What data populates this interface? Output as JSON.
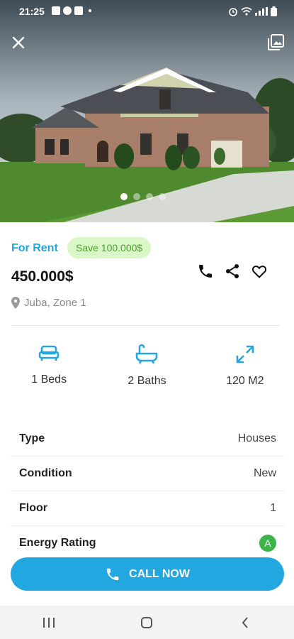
{
  "status_bar": {
    "time": "21:25"
  },
  "gallery": {
    "slides": 4,
    "active_slide": 1
  },
  "listing": {
    "type_label": "For Rent",
    "savings_badge": "Save 100.000$",
    "price": "450.000$",
    "location": "Juba, Zone 1"
  },
  "features": [
    {
      "icon": "bed-icon",
      "label": "1 Beds"
    },
    {
      "icon": "bathtub-icon",
      "label": "2 Baths"
    },
    {
      "icon": "expand-icon",
      "label": "120 M2"
    }
  ],
  "details": [
    {
      "key": "Type",
      "value": "Houses"
    },
    {
      "key": "Condition",
      "value": "New"
    },
    {
      "key": "Floor",
      "value": "1"
    },
    {
      "key": "Energy Rating",
      "value": "A"
    }
  ],
  "call_button": {
    "label": "CALL NOW"
  },
  "colors": {
    "accent": "#22a7e0",
    "save_bg": "#d9f7c7",
    "save_text": "#49a32c",
    "energy": "#3cb44a"
  }
}
